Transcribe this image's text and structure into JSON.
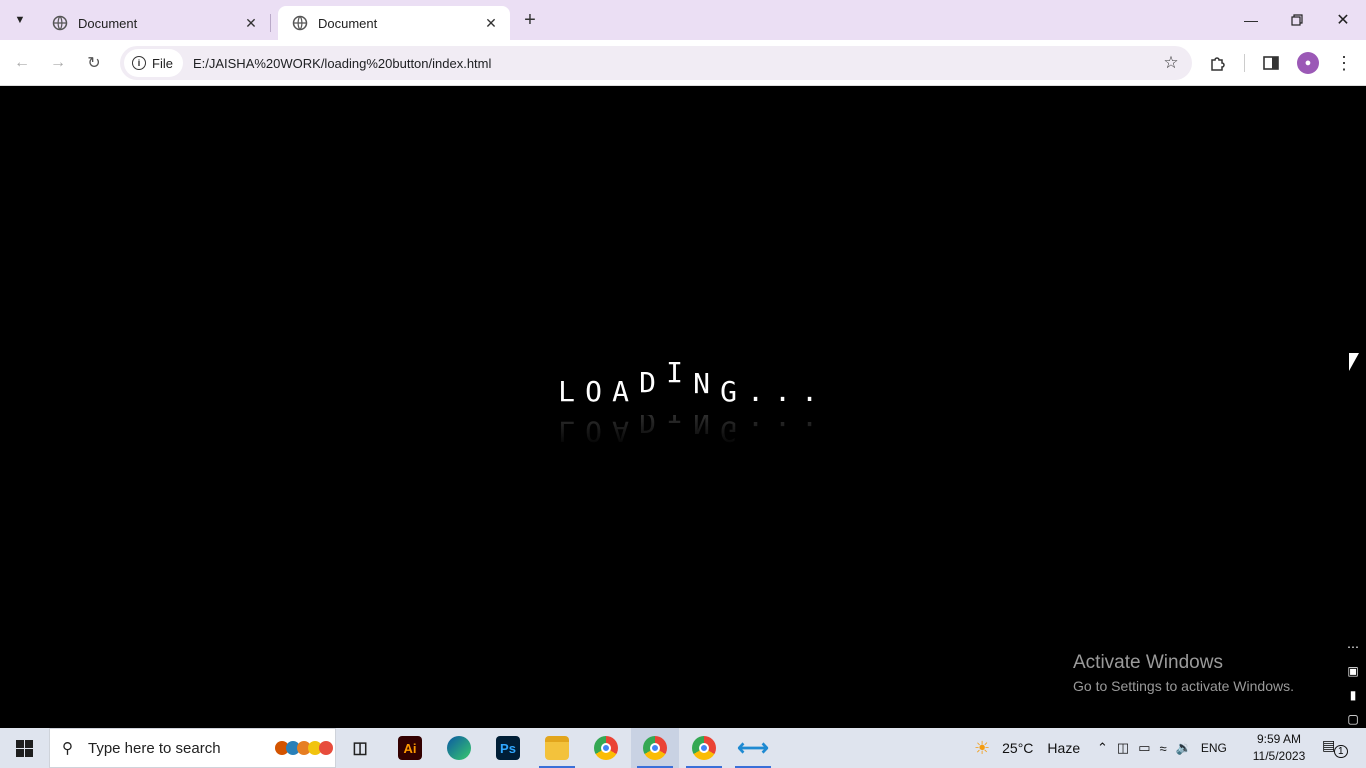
{
  "tabs": [
    {
      "title": "Document",
      "active": false
    },
    {
      "title": "Document",
      "active": true
    }
  ],
  "address_bar": {
    "site_chip": "File",
    "url": "E:/JAISHA%20WORK/loading%20button/index.html"
  },
  "page": {
    "loading_letters": [
      "L",
      "O",
      "A",
      "D",
      "I",
      "N",
      "G",
      ".",
      ".",
      "."
    ],
    "background_color": "#000000",
    "text_color": "#ffffff"
  },
  "watermark": {
    "title": "Activate Windows",
    "subtitle": "Go to Settings to activate Windows."
  },
  "taskbar": {
    "search_placeholder": "Type here to search",
    "apps": [
      "task-view",
      "illustrator",
      "edge",
      "photoshop",
      "file-explorer",
      "chrome",
      "chrome-profile",
      "chrome-profile-2",
      "vscode"
    ],
    "weather": {
      "temperature": "25°C",
      "condition": "Haze"
    },
    "language": "ENG",
    "time": "9:59 AM",
    "date": "11/5/2023",
    "notification_count": "1"
  }
}
